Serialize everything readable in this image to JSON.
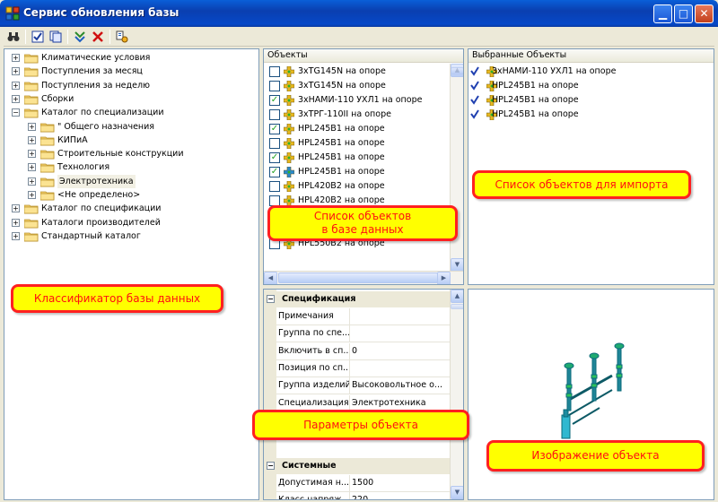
{
  "window": {
    "title": "Сервис обновления базы"
  },
  "toolbar": {
    "icons": [
      "binoculars-icon",
      "check-all-icon",
      "copy-icon",
      "import-icon",
      "delete-icon",
      "settings-icon"
    ]
  },
  "tree": {
    "items": [
      {
        "label": "Климатические условия",
        "level": 0,
        "sign": "+"
      },
      {
        "label": "Поступления за месяц",
        "level": 0,
        "sign": "+"
      },
      {
        "label": "Поступления за неделю",
        "level": 0,
        "sign": "+"
      },
      {
        "label": "Сборки",
        "level": 0,
        "sign": "+"
      },
      {
        "label": "Каталог по специализации",
        "level": 0,
        "sign": "−"
      },
      {
        "label": "\" Общего назначения",
        "level": 1,
        "sign": "+"
      },
      {
        "label": "КИПиА",
        "level": 1,
        "sign": "+"
      },
      {
        "label": "Строительные конструкции",
        "level": 1,
        "sign": "+"
      },
      {
        "label": "Технология",
        "level": 1,
        "sign": "+"
      },
      {
        "label": "Электротехника",
        "level": 1,
        "sign": "+",
        "selected": true
      },
      {
        "label": "<Не определено>",
        "level": 1,
        "sign": "+"
      },
      {
        "label": "Каталог по спецификации",
        "level": 0,
        "sign": "+"
      },
      {
        "label": "Каталоги производителей",
        "level": 0,
        "sign": "+"
      },
      {
        "label": "Стандартный каталог",
        "level": 0,
        "sign": "+"
      }
    ]
  },
  "objects": {
    "header": "Объекты",
    "rows": [
      {
        "label": "3xTG145N на опоре",
        "checked": false
      },
      {
        "label": "3xTG145N на опоре",
        "checked": false
      },
      {
        "label": "3xНАМИ-110 УХЛ1 на опоре",
        "checked": true
      },
      {
        "label": "3xТРГ-110II на опоре",
        "checked": false
      },
      {
        "label": "HPL245B1 на опоре",
        "checked": true
      },
      {
        "label": "HPL245B1 на опоре",
        "checked": false
      },
      {
        "label": "HPL245B1 на опоре",
        "checked": true
      },
      {
        "label": "HPL245B1 на опоре",
        "checked": true,
        "alt": true
      },
      {
        "label": "HPL420B2 на опоре",
        "checked": false
      },
      {
        "label": "HPL420B2 на опоре",
        "checked": false
      },
      {
        "label": "HPL550B2 на опоре",
        "checked": false
      },
      {
        "label": "HPL550B2 на опоре",
        "checked": false
      },
      {
        "label": "HPL550B2 на опоре",
        "checked": false
      }
    ]
  },
  "selected_objects": {
    "header": "Выбранные Объекты",
    "rows": [
      "3xНАМИ-110 УХЛ1 на опоре",
      "HPL245B1 на опоре",
      "HPL245B1 на опоре",
      "HPL245B1 на опоре"
    ]
  },
  "properties": {
    "categories": [
      {
        "title": "Спецификация",
        "sign": "−",
        "rows": [
          {
            "name": "Примечания",
            "value": ""
          },
          {
            "name": "Группа по спе...",
            "value": ""
          },
          {
            "name": "Включить в сп...",
            "value": "0"
          },
          {
            "name": "Позиция по сп...",
            "value": ""
          },
          {
            "name": "Группа изделий",
            "value": "Высоковольтное о..."
          },
          {
            "name": "Специализация",
            "value": "Электротехника"
          }
        ]
      },
      {
        "title": "Системные",
        "sign": "−",
        "rows": [
          {
            "name": "Допустимая н...",
            "value": "1500"
          },
          {
            "name": "Класс напряж...",
            "value": "220"
          }
        ]
      }
    ]
  },
  "callouts": {
    "classifier": "Классификатор базы данных",
    "objects_list": "Список объектов\nв базе данных",
    "import_list": "Список объектов для импорта",
    "object_params": "Параметры объекта",
    "object_image": "Изображение объекта"
  },
  "colors": {
    "title_bar": "#0a5fd8",
    "callout_fill": "#ffff00",
    "callout_border": "#ff2020",
    "check": "#21a121"
  }
}
